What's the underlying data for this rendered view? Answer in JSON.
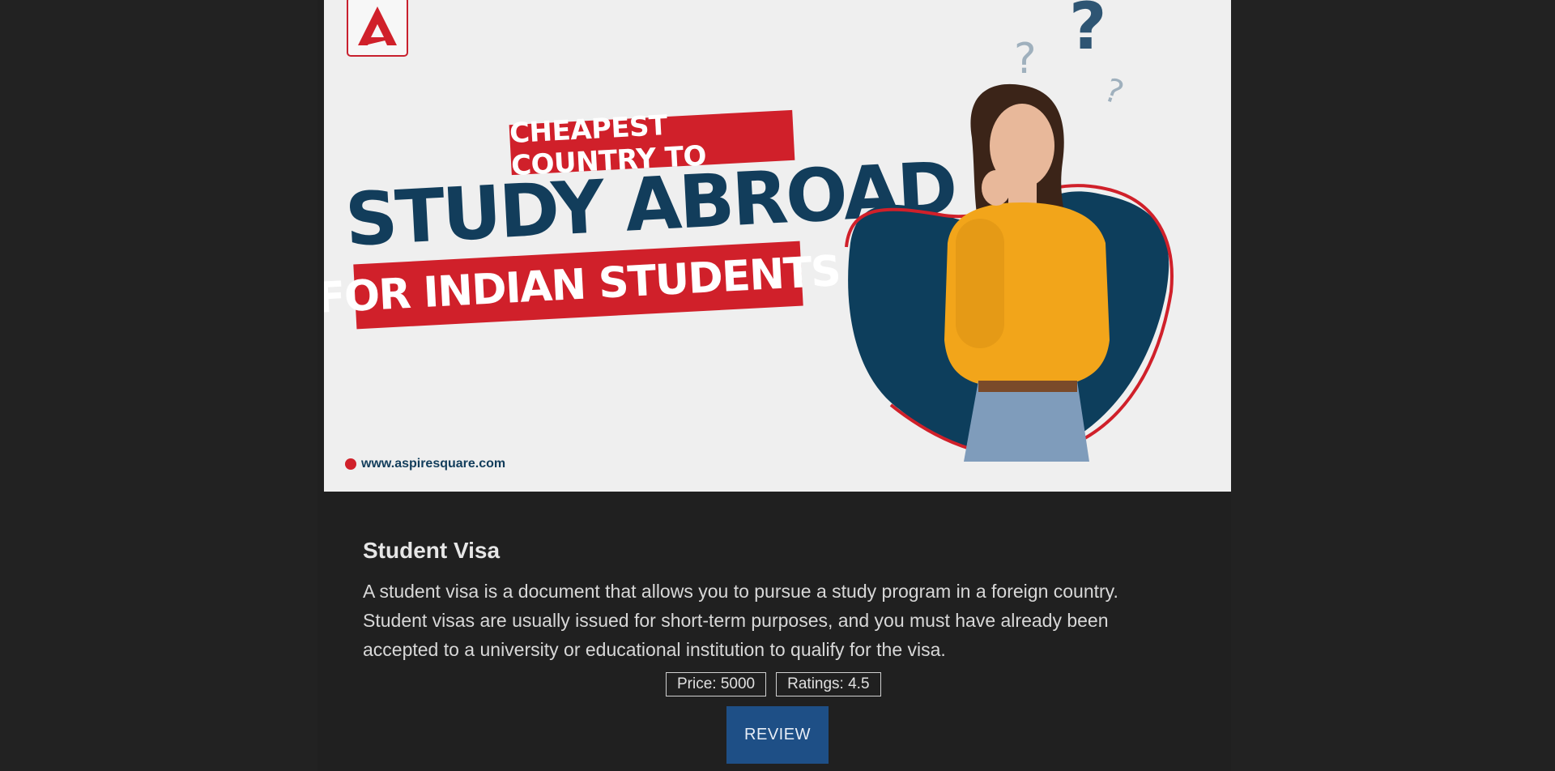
{
  "banner": {
    "tagline_top": "CHEAPEST COUNTRY TO",
    "title": "STUDY ABROAD",
    "tagline_bottom": "FOR INDIAN STUDENTS",
    "website": "www.aspiresquare.com",
    "logo_icon": "aspire-logo-icon",
    "colors": {
      "red": "#d0202a",
      "navy": "#123d5b",
      "bg": "#efefef"
    }
  },
  "card": {
    "title": "Student Visa",
    "description": "A student visa is a document that allows you to pursue a study program in a foreign country. Student visas are usually issued for short-term purposes, and you must have already been accepted to a university or educational institution to qualify for the visa.",
    "price_label": "Price: 5000",
    "ratings_label": "Ratings: 4.5",
    "review_button": "REVIEW"
  },
  "colors": {
    "page_bg": "#222222",
    "button": "#1e4f86"
  }
}
